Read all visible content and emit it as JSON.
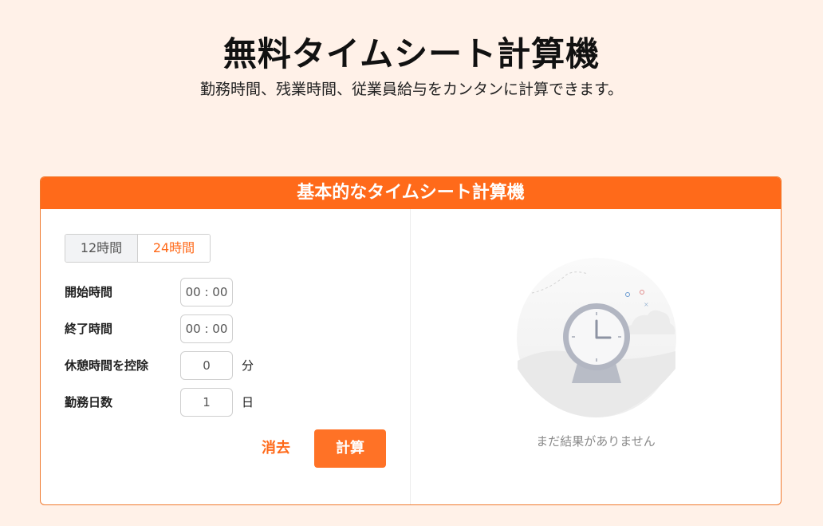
{
  "page": {
    "title": "無料タイムシート計算機",
    "subtitle": "勤務時間、残業時間、従業員給与をカンタンに計算できます。"
  },
  "card": {
    "header": "基本的なタイムシート計算機",
    "toggle": {
      "option_12": "12時間",
      "option_24": "24時間",
      "selected": "24時間"
    },
    "fields": {
      "start": {
        "label": "開始時間",
        "value": "00 : 00"
      },
      "end": {
        "label": "終了時間",
        "value": "00 : 00"
      },
      "break": {
        "label": "休憩時間を控除",
        "value": "0",
        "unit": "分"
      },
      "days": {
        "label": "勤務日数",
        "value": "1",
        "unit": "日"
      }
    },
    "buttons": {
      "clear": "消去",
      "calculate": "計算"
    },
    "result": {
      "empty_text": "まだ結果がありません"
    }
  },
  "colors": {
    "accent": "#ff6a1a",
    "background": "#fff1e8"
  }
}
